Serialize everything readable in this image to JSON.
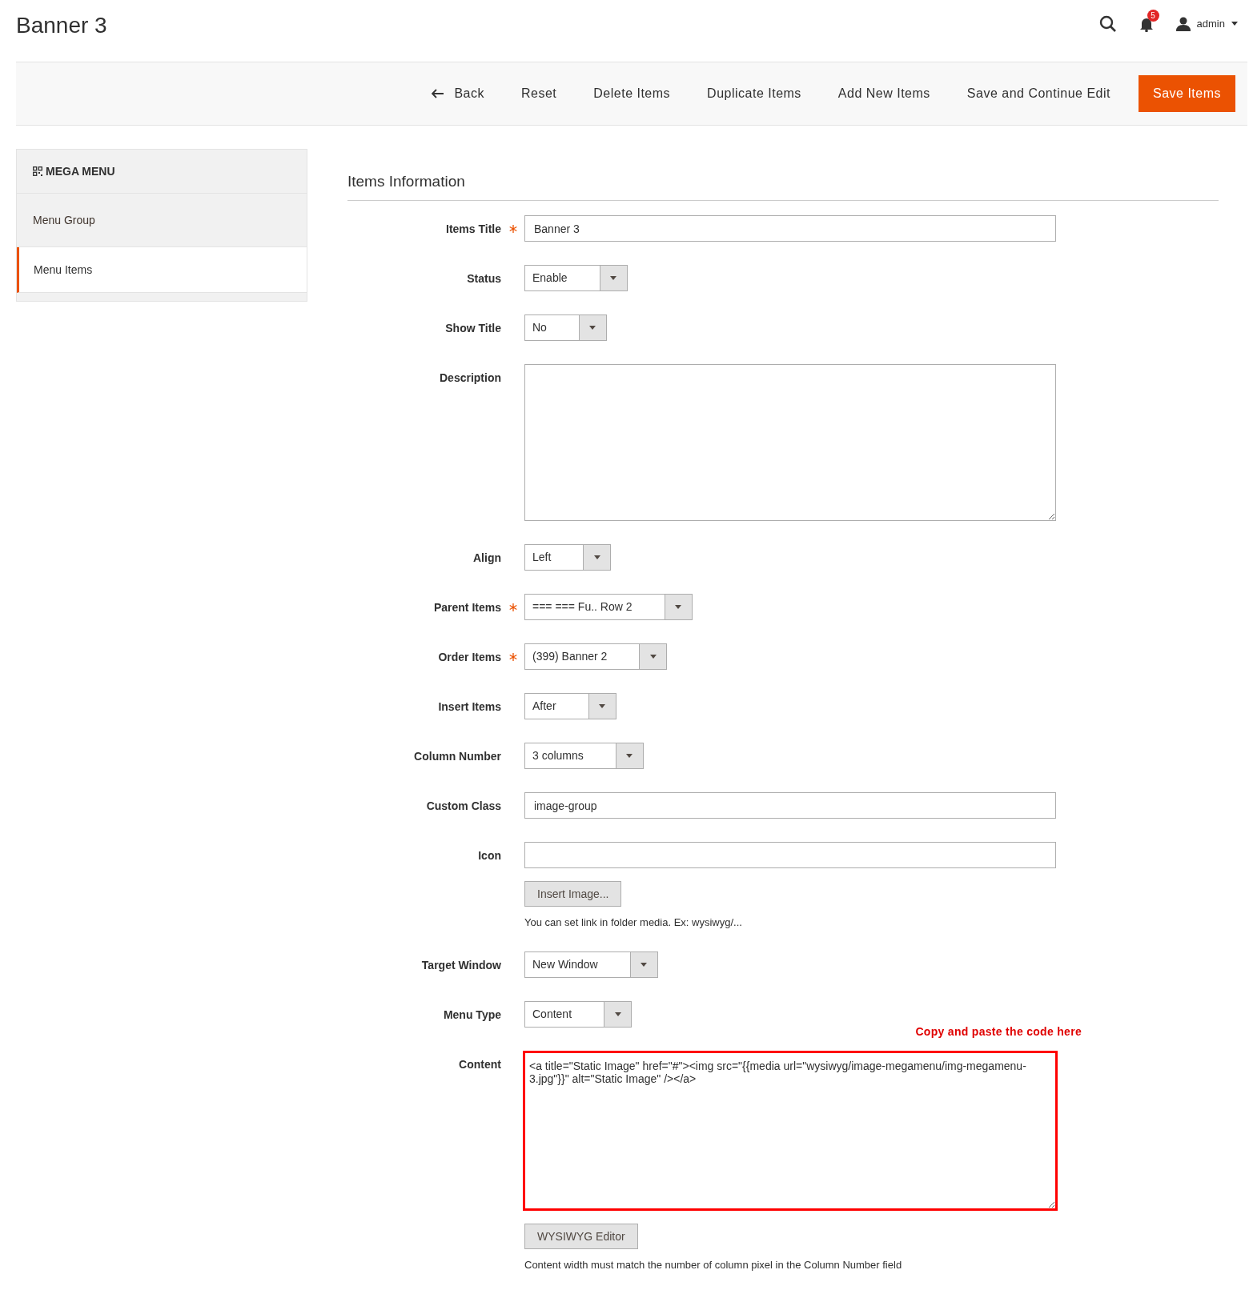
{
  "page_title": "Banner 3",
  "header": {
    "notification_count": "5",
    "user": "admin"
  },
  "toolbar": [
    {
      "label": "Back",
      "kind": "back",
      "primary": false
    },
    {
      "label": "Reset",
      "kind": "plain",
      "primary": false
    },
    {
      "label": "Delete Items",
      "kind": "plain",
      "primary": false
    },
    {
      "label": "Duplicate Items",
      "kind": "plain",
      "primary": false
    },
    {
      "label": "Add New Items",
      "kind": "plain",
      "primary": false
    },
    {
      "label": "Save and Continue Edit",
      "kind": "plain",
      "primary": false
    },
    {
      "label": "Save Items",
      "kind": "plain",
      "primary": true
    }
  ],
  "sidebar": {
    "title": "MEGA MENU",
    "items": [
      {
        "label": "Menu Group",
        "selected": false
      },
      {
        "label": "Menu Items",
        "selected": true
      }
    ]
  },
  "section_title": "Items Information",
  "fields": [
    {
      "label": "Items Title",
      "required": true,
      "kind": "text",
      "value": "Banner 3"
    },
    {
      "label": "Status",
      "required": false,
      "kind": "select",
      "value": "Enable"
    },
    {
      "label": "Show Title",
      "required": false,
      "kind": "select",
      "value": "No"
    },
    {
      "label": "Description",
      "required": false,
      "kind": "textarea"
    },
    {
      "label": "Align",
      "required": false,
      "kind": "select",
      "value": "Left"
    },
    {
      "label": "Parent Items",
      "required": true,
      "kind": "select",
      "value": "=== === Fu.. Row 2"
    },
    {
      "label": "Order Items",
      "required": true,
      "kind": "select",
      "value": "(399) Banner 2"
    },
    {
      "label": "Insert Items",
      "required": false,
      "kind": "select",
      "value": "After"
    },
    {
      "label": "Column Number",
      "required": false,
      "kind": "select",
      "value": "3 columns"
    },
    {
      "label": "Custom Class",
      "required": false,
      "kind": "text",
      "value": "image-group"
    },
    {
      "label": "Icon",
      "required": false,
      "kind": "text",
      "button": "Insert Image...",
      "note": "You can set link in folder media. Ex: wysiwyg/..."
    },
    {
      "label": "Target Window",
      "required": false,
      "kind": "select",
      "value": "New Window"
    },
    {
      "label": "Menu Type",
      "required": false,
      "kind": "select",
      "value": "Content"
    },
    {
      "label": "Content",
      "required": false,
      "kind": "textarea",
      "highlighted": true,
      "annotation": "Copy and paste the code here",
      "value": "<a title=\"Static Image\" href=\"#\"><img src=\"{{media url=\"wysiwyg/image-megamenu/img-megamenu-3.jpg\"}}\" alt=\"Static Image\" /></a>",
      "button": "WYSIWYG Editor",
      "note": "Content width must match the number of column pixel in the Column Number field"
    }
  ]
}
